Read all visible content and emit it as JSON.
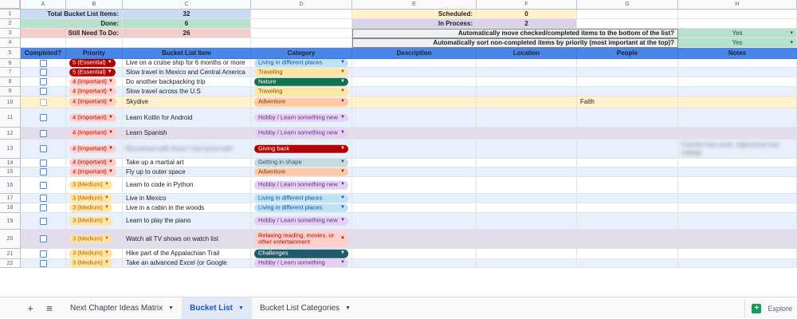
{
  "colors": {
    "header_blue": "#4a86e8",
    "summary_blue": "#c9daf8",
    "summary_green": "#b7e1cd",
    "summary_red": "#f4cccc",
    "summary_yellow": "#fff2cc",
    "summary_purple": "#d9d2e9",
    "settings_gray": "#efefef",
    "yes_green": "#b7e1cd",
    "row_alt": "#e8f0fe",
    "row_purple": "#e2dcec",
    "row_yellow": "#fff2cc",
    "essential": "#b10202",
    "important": "#ffcfc9",
    "medium": "#ffe5a0"
  },
  "column_letters": [
    "A",
    "B",
    "C",
    "D",
    "E",
    "F",
    "G",
    "H"
  ],
  "row_numbers": [
    "1",
    "2",
    "3",
    "4",
    "5",
    "6",
    "7",
    "8",
    "9",
    "10",
    "11",
    "12",
    "13",
    "14",
    "15",
    "16",
    "17",
    "18",
    "19",
    "20",
    "21",
    "22"
  ],
  "summary": {
    "total_label": "Total Bucket List Items:",
    "total_value": "32",
    "done_label": "Done:",
    "done_value": "6",
    "need_label": "Still Need To Do:",
    "need_value": "26",
    "scheduled_label": "Scheduled:",
    "scheduled_value": "0",
    "inprocess_label": "In Process:",
    "inprocess_value": "2"
  },
  "settings": [
    {
      "label": "Automatically move checked/completed items to the bottom of the list?",
      "value": "Yes"
    },
    {
      "label": "Automatically sort non-completed items by priority (most important at the top)?",
      "value": "Yes"
    }
  ],
  "headers": [
    "Completed?",
    "Priority",
    "Bucket List Item",
    "Category",
    "Description",
    "Location",
    "People",
    "Notes"
  ],
  "rows": [
    {
      "priority": "5 (Essential)",
      "pcls": "essential",
      "item": "Live on a cruise ship for 6 months or more",
      "category": "Living in different places",
      "ccls": "living",
      "desc": "",
      "people": "",
      "notes": "",
      "bg": "white",
      "blur": false
    },
    {
      "priority": "5 (Essential)",
      "pcls": "essential",
      "item": "Slow travel in Mexico and Central America",
      "category": "Traveling",
      "ccls": "traveling",
      "desc": "",
      "people": "",
      "notes": "",
      "bg": "alt",
      "blur": false
    },
    {
      "priority": "4 (Important)",
      "pcls": "important",
      "item": "Do another backpacking trip",
      "category": "Nature",
      "ccls": "nature",
      "desc": "",
      "people": "",
      "notes": "",
      "bg": "white",
      "blur": false
    },
    {
      "priority": "4 (Important)",
      "pcls": "important",
      "item": "Slow travel across the U.S",
      "category": "Traveling",
      "ccls": "traveling",
      "desc": "",
      "people": "",
      "notes": "",
      "bg": "alt",
      "blur": false
    },
    {
      "priority": "4 (Important)",
      "pcls": "important",
      "item": "Skydive",
      "category": "Adventure",
      "ccls": "adventure",
      "desc": "",
      "people": "Faith",
      "notes": "",
      "bg": "yellow",
      "blur": false
    },
    {
      "priority": "4 (Important)",
      "pcls": "important",
      "item": "Learn Kotlin for Android",
      "category": "Hobby / Learn something new",
      "ccls": "hobby",
      "desc": "",
      "people": "",
      "notes": "",
      "bg": "alt",
      "blur": false
    },
    {
      "priority": "4 (Important)",
      "pcls": "important",
      "item": "Learn Spanish",
      "category": "Hobby / Learn something new",
      "ccls": "hobby",
      "desc": "",
      "people": "",
      "notes": "",
      "bg": "purple",
      "blur": false
    },
    {
      "priority": "4 (Important)",
      "pcls": "important",
      "item": "Reconnect with those I lost touch with",
      "category": "Giving back",
      "ccls": "giving",
      "desc": "",
      "people": "",
      "notes": "Friends from work, highschool and college",
      "bg": "alt",
      "blur": true
    },
    {
      "priority": "4 (Important)",
      "pcls": "important",
      "item": "Take up a martial art",
      "category": "Getting in shape",
      "ccls": "shape",
      "desc": "",
      "people": "",
      "notes": "",
      "bg": "white",
      "blur": false
    },
    {
      "priority": "4 (Important)",
      "pcls": "important",
      "item": "Fly up to outer space",
      "category": "Adventure",
      "ccls": "adventure",
      "desc": "",
      "people": "",
      "notes": "",
      "bg": "alt",
      "blur": false
    },
    {
      "priority": "3 (Medium)",
      "pcls": "medium",
      "item": "Learn to code in Python",
      "category": "Hobby / Learn something new",
      "ccls": "hobby",
      "desc": "",
      "people": "",
      "notes": "",
      "bg": "white",
      "blur": false
    },
    {
      "priority": "3 (Medium)",
      "pcls": "medium",
      "item": "Live in Mexico",
      "category": "Living in different places",
      "ccls": "living",
      "desc": "",
      "people": "",
      "notes": "",
      "bg": "alt",
      "blur": false
    },
    {
      "priority": "3 (Medium)",
      "pcls": "medium",
      "item": "Live in a cabin in the woods",
      "category": "Living in different places",
      "ccls": "living",
      "desc": "",
      "people": "",
      "notes": "",
      "bg": "white",
      "blur": false
    },
    {
      "priority": "3 (Medium)",
      "pcls": "medium",
      "item": "Learn to play the piano",
      "category": "Hobby / Learn something new",
      "ccls": "hobby",
      "desc": "",
      "people": "",
      "notes": "",
      "bg": "alt",
      "blur": false
    },
    {
      "priority": "3 (Medium)",
      "pcls": "medium",
      "item": "Watch all TV shows on watch list",
      "category": "Relaxing reading, movies, or other entertainment",
      "ccls": "relax",
      "desc": "",
      "people": "",
      "notes": "",
      "bg": "purple",
      "blur": false
    },
    {
      "priority": "3 (Medium)",
      "pcls": "medium",
      "item": "Hike part of the Appalachian Trail",
      "category": "Challenges",
      "ccls": "challenges",
      "desc": "",
      "people": "",
      "notes": "",
      "bg": "white",
      "blur": false
    },
    {
      "priority": "3 (Medium)",
      "pcls": "medium",
      "item": "Take an advanced Excel (or Google",
      "category": "Hobby / Learn something",
      "ccls": "hobby",
      "desc": "",
      "people": "",
      "notes": "",
      "bg": "alt",
      "blur": false
    }
  ],
  "tabs": [
    {
      "label": "Next Chapter Ideas Matrix",
      "active": false
    },
    {
      "label": "Bucket List",
      "active": true
    },
    {
      "label": "Bucket List Categories",
      "active": false
    }
  ],
  "explore_label": "Explore"
}
